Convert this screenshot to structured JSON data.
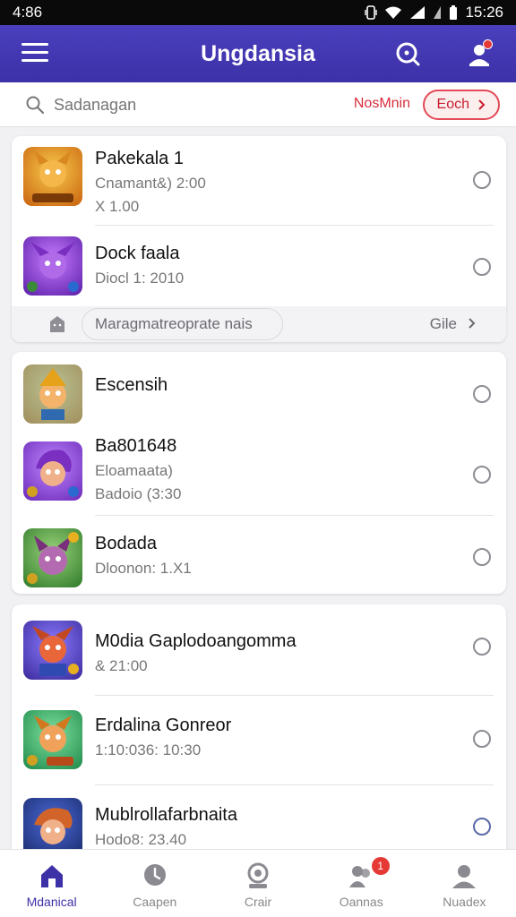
{
  "status_bar": {
    "time_left": "4:86",
    "time_right": "15:26"
  },
  "app_bar": {
    "title": "Ungdansia"
  },
  "search": {
    "placeholder": "Sadanagan",
    "filter_label": "NosMnin",
    "filter_chip_label": "Eoch"
  },
  "cards": [
    {
      "rows": [
        {
          "title": "Pakekala 1",
          "lines": [
            "Cnamant&) 2:00",
            "X 1.00"
          ],
          "avatar": "#e8a21a"
        },
        {
          "title": "Dock faala",
          "lines": [
            "Diocl 1: 2010"
          ],
          "avatar": "#8b3fd0"
        }
      ],
      "footer": {
        "label": "Maragmatreoprate nais",
        "link": "Gile"
      }
    },
    {
      "rows": [
        {
          "title": "Escensih",
          "lines": [],
          "avatar": "#f0a43a"
        },
        {
          "title": "Ba801648",
          "lines": [
            "Eloamaata)",
            "Badoio  (3:30"
          ],
          "avatar": "#9a4bd8"
        },
        {
          "title": "Bodada",
          "lines": [
            "Dloonon: 1.X1"
          ],
          "avatar": "#4a9a3a"
        }
      ]
    },
    {
      "rows": [
        {
          "title": "M0dia Gaplodoangomma",
          "lines": [
            "& 21:00"
          ],
          "avatar": "#6a4fd0"
        },
        {
          "title": "Erdalina Gonreor",
          "lines": [
            "1:10:036: 10:30"
          ],
          "avatar": "#2fae6e"
        },
        {
          "title": "Mublrollafarbnaita",
          "lines": [
            "Hodo8: 23.40"
          ],
          "avatar": "#2a3f8a"
        }
      ]
    }
  ],
  "bottom_nav": [
    {
      "label": "Mdanical",
      "icon": "home-icon",
      "active": true
    },
    {
      "label": "Caapen",
      "icon": "clock-icon"
    },
    {
      "label": "Crair",
      "icon": "chat-icon"
    },
    {
      "label": "Oannas",
      "icon": "people-icon",
      "badge": "1"
    },
    {
      "label": "Nuadex",
      "icon": "profile-icon"
    }
  ]
}
